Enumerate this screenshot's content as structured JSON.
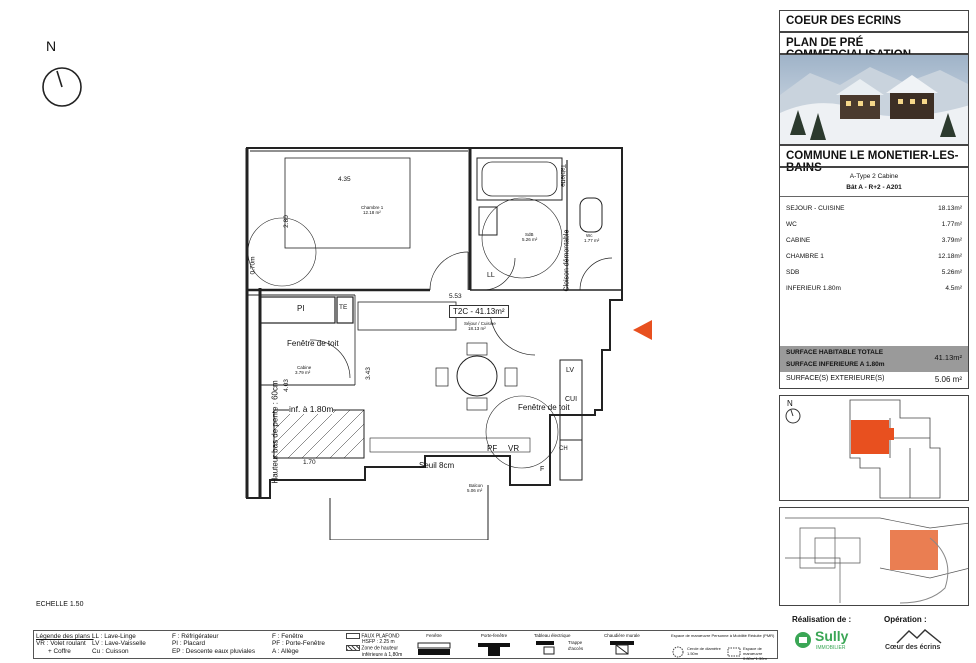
{
  "compass": {
    "north_label": "N"
  },
  "scale_label": "ECHELLE 1.50",
  "plan": {
    "dim_435": "4.35",
    "dim_280": "2.80",
    "dim_070": "0.70m",
    "dim_553": "5.53",
    "dim_343": "3.43",
    "dim_403": "4.03",
    "dim_170": "1.70",
    "chambre_name": "Chambre 1",
    "chambre_area": "12.18 m²",
    "sdb_name": "SdB",
    "sdb_area": "5.26 m²",
    "wc_name": "Wc",
    "wc_area": "1.77 m²",
    "cabine_name": "Cabine",
    "cabine_area": "3.79 m²",
    "sejour_name": "Séjour / Cuisine",
    "sejour_area": "18.13 m²",
    "balcon_name": "Balcon",
    "balcon_area": "5.06 m²",
    "tablette": "Tablette",
    "cloison": "Cloison démontable",
    "ll": "LL",
    "pi": "PI",
    "te": "TE",
    "lv": "LV",
    "cui": "CUI",
    "ch": "CH",
    "pf": "PF",
    "vr": "VR",
    "f": "F",
    "badge": "T2C - 41.13m²",
    "fenetre_toit_1": "Fenêtre de toit",
    "fenetre_toit_2": "Fenêtre de toit",
    "hauteur": "Hauteur bas de pente : 60cm",
    "inf_180": "inf. à 1.80m",
    "seuil": "Seuil 8cm"
  },
  "cartouche": {
    "title1": "COEUR DES ECRINS",
    "title2": "PLAN DE PRÉ COMMERCIALISATION",
    "commune": "COMMUNE LE MONETIER-LES-BAINS",
    "type_line": "A-Type 2 Cabine",
    "lot_line": "Bât A - R+2 - A201",
    "rooms": [
      {
        "name": "SEJOUR - CUISINE",
        "area": "18.13m²"
      },
      {
        "name": "WC",
        "area": "1.77m²"
      },
      {
        "name": "CABINE",
        "area": "3.79m²"
      },
      {
        "name": "CHAMBRE 1",
        "area": "12.18m²"
      },
      {
        "name": "SDB",
        "area": "5.26m²"
      },
      {
        "name": "INFERIEUR 1.80m",
        "area": "4.5m²"
      }
    ],
    "surface_habitable_label": "SURFACE HABITABLE TOTALE",
    "surface_habitable_value": "41.13m²",
    "surface_inferieure_label": "SURFACE INFERIEURE A 1.80m",
    "surface_ext_label": "SURFACE(S) EXTERIEURE(S)",
    "surface_ext_value": "5.06 m²",
    "north_label": "N",
    "realisation_label": "Réalisation de :",
    "operation_label": "Opération :",
    "sully_logo": "Sully",
    "sully_sub": "IMMOBILIER",
    "coeur_logo": "Cœur des écrins"
  },
  "legend": {
    "title": "Légende des plans :",
    "col1": [
      "LL : Lave-Linge",
      "LV : Lave-Vaisselle",
      "Cu : Cuisson"
    ],
    "col0": [
      "VR : Volet roulant",
      "+ Coffre"
    ],
    "col2": [
      "F : Réfrigérateur",
      "PI : Placard",
      "EP : Descente eaux pluviales"
    ],
    "col3": [
      "F : Fenêtre",
      "PF : Porte-Fenêtre",
      "A : Allège"
    ],
    "faux_plafond": "FAUX PLAFOND",
    "hsfp": "HSFP : 2.25 m",
    "zone_hauteur": "Zone de hauteur",
    "zone_hauteur2": "inférieure à 1,80m",
    "fenetre": "Fenêtre",
    "porte_fenetre": "Porte-fenêtre",
    "tableau": "Tableau électrique",
    "trappe": "Trappe d'accès",
    "chaudiere": "Chaudière murale",
    "espace1": "Espace de manœuvre Personne à Mobilité Réduite (PMR)",
    "cercle": "Cercle de diamètre 1.50m",
    "espace2": "Espace de manœuvre 0.80m*1.30m"
  }
}
